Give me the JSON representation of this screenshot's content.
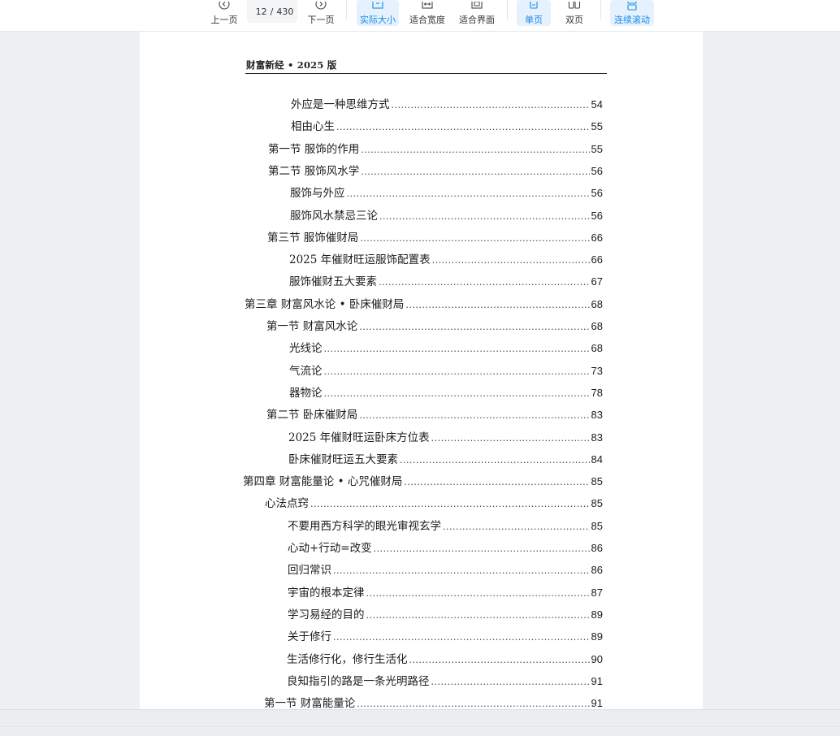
{
  "toolbar": {
    "prev_label": "上一页",
    "next_label": "下一页",
    "current_page": "12",
    "page_separator": "/",
    "total_pages": "430",
    "actual_size_label": "实际大小",
    "fit_width_label": "适合宽度",
    "fit_page_label": "适合界面",
    "single_page_label": "单页",
    "double_page_label": "双页",
    "continuous_label": "连续滚动",
    "active_color": "#1a8ae8"
  },
  "document": {
    "running_head": "财富新经 • 2025 版",
    "toc": [
      {
        "title": "外应是一种思维方式",
        "page": "54"
      },
      {
        "title": "相由心生",
        "page": "55"
      },
      {
        "title": "第一节 服饰的作用",
        "page": "55"
      },
      {
        "title": "第二节 服饰风水学",
        "page": "56"
      },
      {
        "title": "服饰与外应",
        "page": "56"
      },
      {
        "title": "服饰风水禁忌三论",
        "page": "56"
      },
      {
        "title": "第三节 服饰催财局",
        "page": "66"
      },
      {
        "title": "2025 年催财旺运服饰配置表",
        "page": "66"
      },
      {
        "title": "服饰催财五大要素",
        "page": "67"
      },
      {
        "title": "第三章 财富风水论 • 卧床催财局",
        "page": "68"
      },
      {
        "title": "第一节 财富风水论",
        "page": "68"
      },
      {
        "title": "光线论",
        "page": "68"
      },
      {
        "title": "气流论",
        "page": "73"
      },
      {
        "title": "器物论",
        "page": "78"
      },
      {
        "title": "第二节 卧床催财局",
        "page": "83"
      },
      {
        "title": "2025 年催财旺运卧床方位表",
        "page": "83"
      },
      {
        "title": "卧床催财旺运五大要素",
        "page": "84"
      },
      {
        "title": "第四章 财富能量论 • 心咒催财局",
        "page": "85"
      },
      {
        "title": "心法点窍",
        "page": "85"
      },
      {
        "title": "不要用西方科学的眼光审视玄学",
        "page": "85"
      },
      {
        "title": "心动+行动=改变",
        "page": "86"
      },
      {
        "title": "回归常识",
        "page": "86"
      },
      {
        "title": "宇宙的根本定律",
        "page": "87"
      },
      {
        "title": "学习易经的目的",
        "page": "89"
      },
      {
        "title": "关于修行",
        "page": "89"
      },
      {
        "title": "生活修行化，修行生活化",
        "page": "90"
      },
      {
        "title": "良知指引的路是一条光明路径",
        "page": "91"
      },
      {
        "title": "第一节 财富能量论",
        "page": "91"
      }
    ]
  }
}
